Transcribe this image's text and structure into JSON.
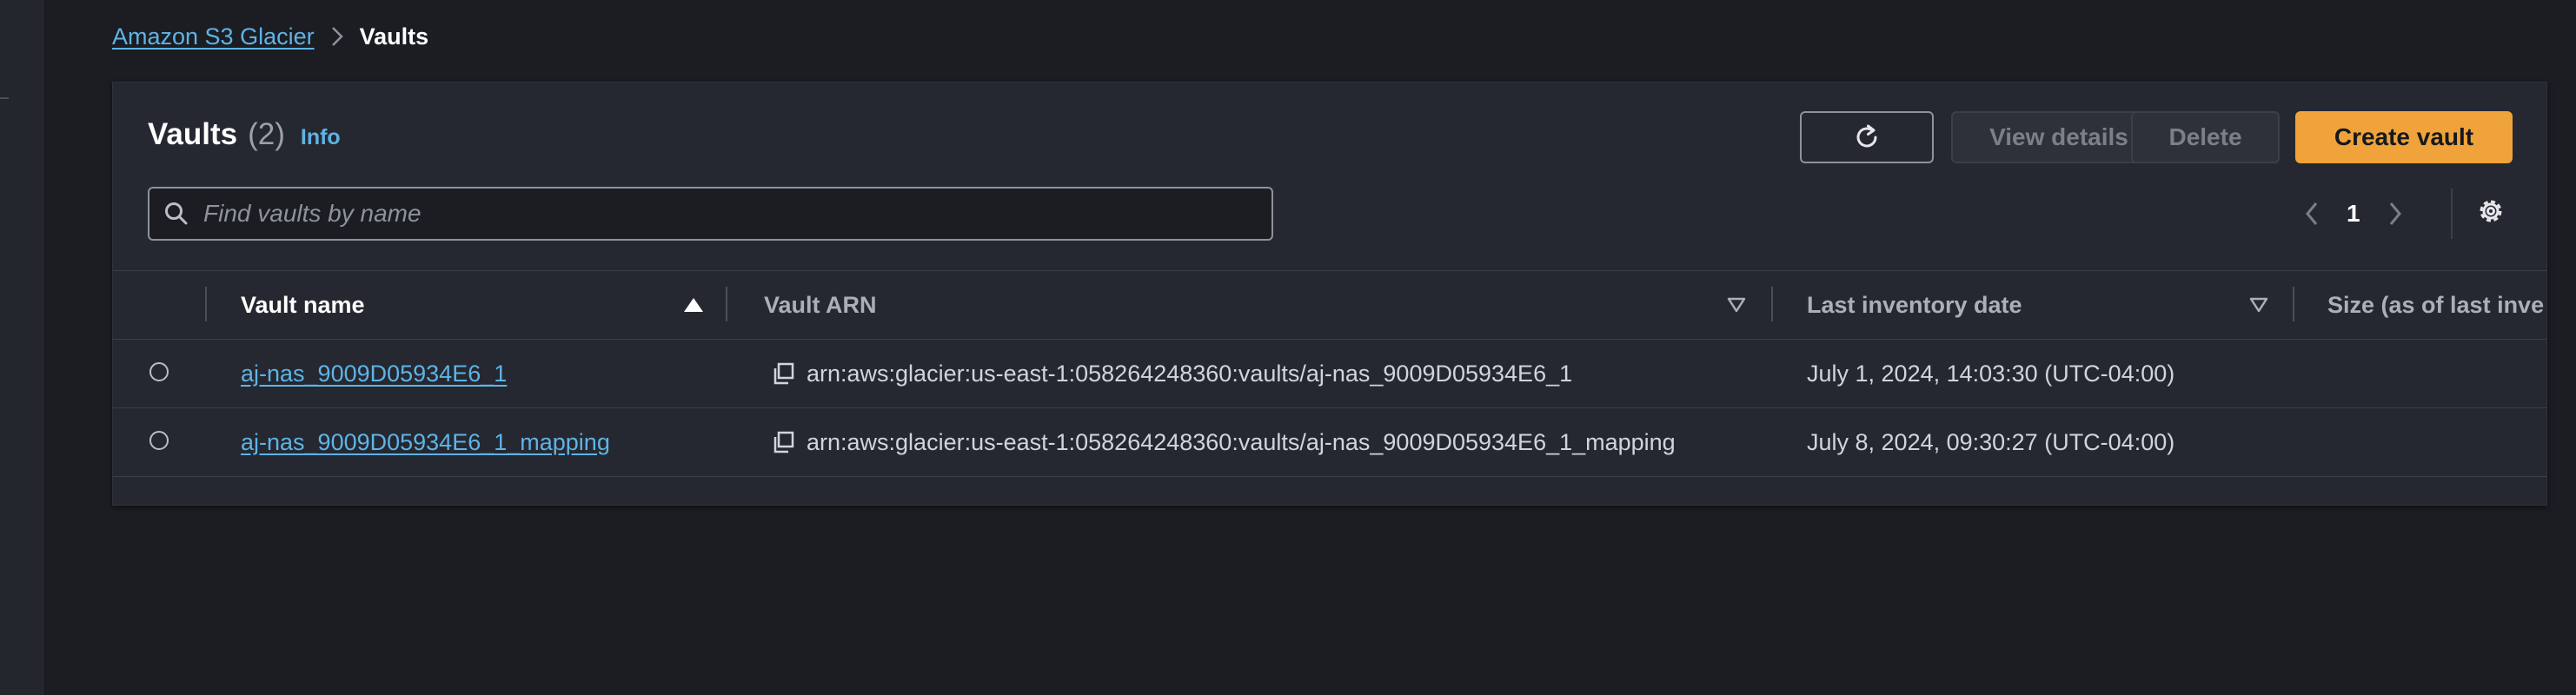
{
  "breadcrumb": {
    "parent": "Amazon S3 Glacier",
    "current": "Vaults"
  },
  "header": {
    "title": "Vaults",
    "count": "(2)",
    "info": "Info"
  },
  "toolbar": {
    "view_details": "View details",
    "delete": "Delete",
    "create_vault": "Create vault"
  },
  "search": {
    "placeholder": "Find vaults by name",
    "value": ""
  },
  "pagination": {
    "current_page": "1"
  },
  "table": {
    "columns": [
      "Vault name",
      "Vault ARN",
      "Last inventory date",
      "Size (as of last inve"
    ],
    "rows": [
      {
        "name": "aj-nas_9009D05934E6_1",
        "arn": "arn:aws:glacier:us-east-1:058264248360:vaults/aj-nas_9009D05934E6_1",
        "last_inventory": "July 1, 2024, 14:03:30 (UTC-04:00)",
        "size": ""
      },
      {
        "name": "aj-nas_9009D05934E6_1_mapping",
        "arn": "arn:aws:glacier:us-east-1:058264248360:vaults/aj-nas_9009D05934E6_1_mapping",
        "last_inventory": "July 8, 2024, 09:30:27 (UTC-04:00)",
        "size": ""
      }
    ]
  },
  "colors": {
    "accent": "#f0a33a",
    "link": "#5fb3e6",
    "background": "#1b1d23",
    "panel": "#252830"
  }
}
